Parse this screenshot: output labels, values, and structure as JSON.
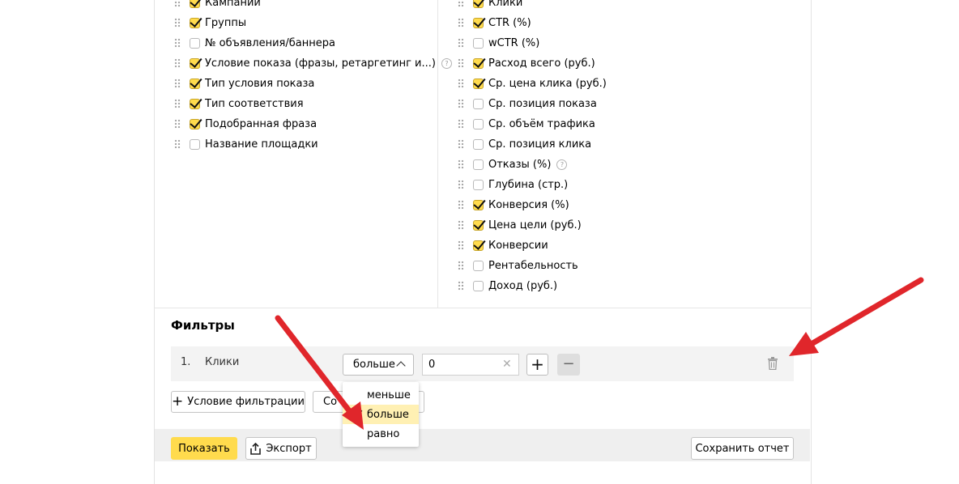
{
  "columns": {
    "left": [
      {
        "label": "Кампании",
        "checked": true,
        "help": false
      },
      {
        "label": "Группы",
        "checked": true,
        "help": false
      },
      {
        "label": "№ объявления/баннера",
        "checked": false,
        "help": false
      },
      {
        "label": "Условие показа (фразы, ретаргетинг и...)",
        "checked": true,
        "help": true
      },
      {
        "label": "Тип условия показа",
        "checked": true,
        "help": false
      },
      {
        "label": "Тип соответствия",
        "checked": true,
        "help": false
      },
      {
        "label": "Подобранная фраза",
        "checked": true,
        "help": false
      },
      {
        "label": "Название площадки",
        "checked": false,
        "help": false
      }
    ],
    "right": [
      {
        "label": "Клики",
        "checked": true,
        "help": false
      },
      {
        "label": "CTR (%)",
        "checked": true,
        "help": false
      },
      {
        "label": "wCTR (%)",
        "checked": false,
        "help": false
      },
      {
        "label": "Расход всего (руб.)",
        "checked": true,
        "help": false
      },
      {
        "label": "Ср. цена клика (руб.)",
        "checked": true,
        "help": false
      },
      {
        "label": "Ср. позиция показа",
        "checked": false,
        "help": false
      },
      {
        "label": "Ср. объём трафика",
        "checked": false,
        "help": false
      },
      {
        "label": "Ср. позиция клика",
        "checked": false,
        "help": false
      },
      {
        "label": "Отказы (%)",
        "checked": false,
        "help": true
      },
      {
        "label": "Глубина (стр.)",
        "checked": false,
        "help": false
      },
      {
        "label": "Конверсия (%)",
        "checked": true,
        "help": false
      },
      {
        "label": "Цена цели (руб.)",
        "checked": true,
        "help": false
      },
      {
        "label": "Конверсии",
        "checked": true,
        "help": false
      },
      {
        "label": "Рентабельность",
        "checked": false,
        "help": false
      },
      {
        "label": "Доход (руб.)",
        "checked": false,
        "help": false
      }
    ]
  },
  "help_glyph": "?",
  "filters": {
    "title": "Фильтры",
    "rows": [
      {
        "number": "1.",
        "field": "Клики",
        "operator": "больше",
        "value": "0"
      }
    ],
    "clear_glyph": "✕",
    "add_glyph": "+",
    "remove_glyph": "−",
    "operator_options": [
      {
        "label": "меньше",
        "selected": false
      },
      {
        "label": "больше",
        "selected": true
      },
      {
        "label": "равно",
        "selected": false
      }
    ],
    "add_condition_plus": "+",
    "add_condition_label": "Условие фильтрации",
    "save_set_label": "Со"
  },
  "footer": {
    "show_label": "Показать",
    "export_label": "Экспорт",
    "save_report_label": "Сохранить отчет"
  },
  "colors": {
    "accent_yellow": "#ffdb4d",
    "annotation_arrow": "#e0262b"
  },
  "icons": [
    "drag-handle-icon",
    "help-icon",
    "clear-icon",
    "trash-icon",
    "export-icon",
    "check-icon"
  ]
}
